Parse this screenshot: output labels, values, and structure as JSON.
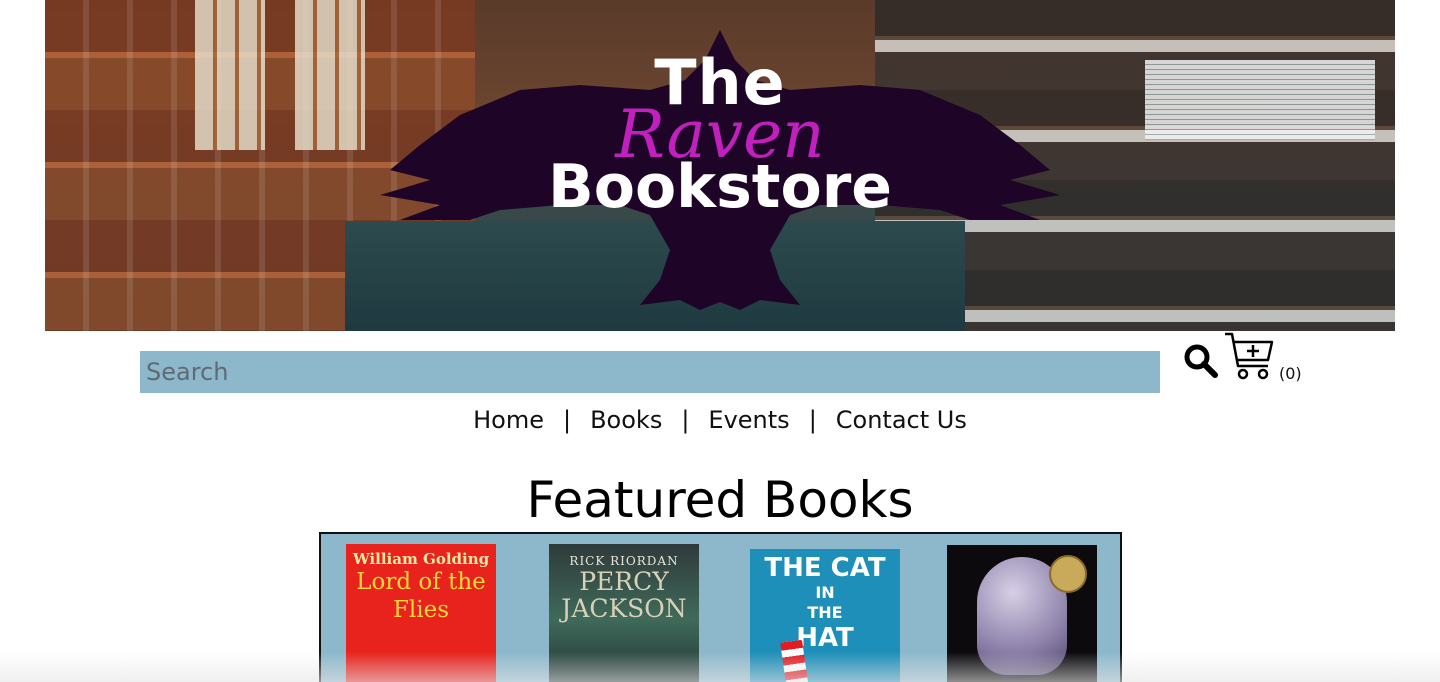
{
  "banner": {
    "logo_the": "The",
    "logo_raven": "Raven",
    "logo_bookstore": "Bookstore",
    "raven_color": "#1e0427",
    "raven_script_color": "#c21fbf"
  },
  "search": {
    "placeholder": "Search",
    "value": "",
    "icon": "search-icon"
  },
  "cart": {
    "icon": "shopping-cart-add-icon",
    "count_label": "(0)"
  },
  "nav": {
    "items": [
      {
        "label": "Home"
      },
      {
        "label": "Books"
      },
      {
        "label": "Events"
      },
      {
        "label": "Contact Us"
      }
    ],
    "separator": "|"
  },
  "featured": {
    "title": "Featured Books",
    "panel_color": "#8db8cb",
    "books": [
      {
        "author": "William Golding",
        "title": "Lord of the Flies"
      },
      {
        "author": "RICK RIORDAN",
        "title": "PERCY JACKSON"
      },
      {
        "title_line1": "THE CAT",
        "title_line2": "IN",
        "title_line3": "THE",
        "title_line4": "HAT"
      },
      {
        "cover": "purple-hood-cover"
      }
    ]
  }
}
